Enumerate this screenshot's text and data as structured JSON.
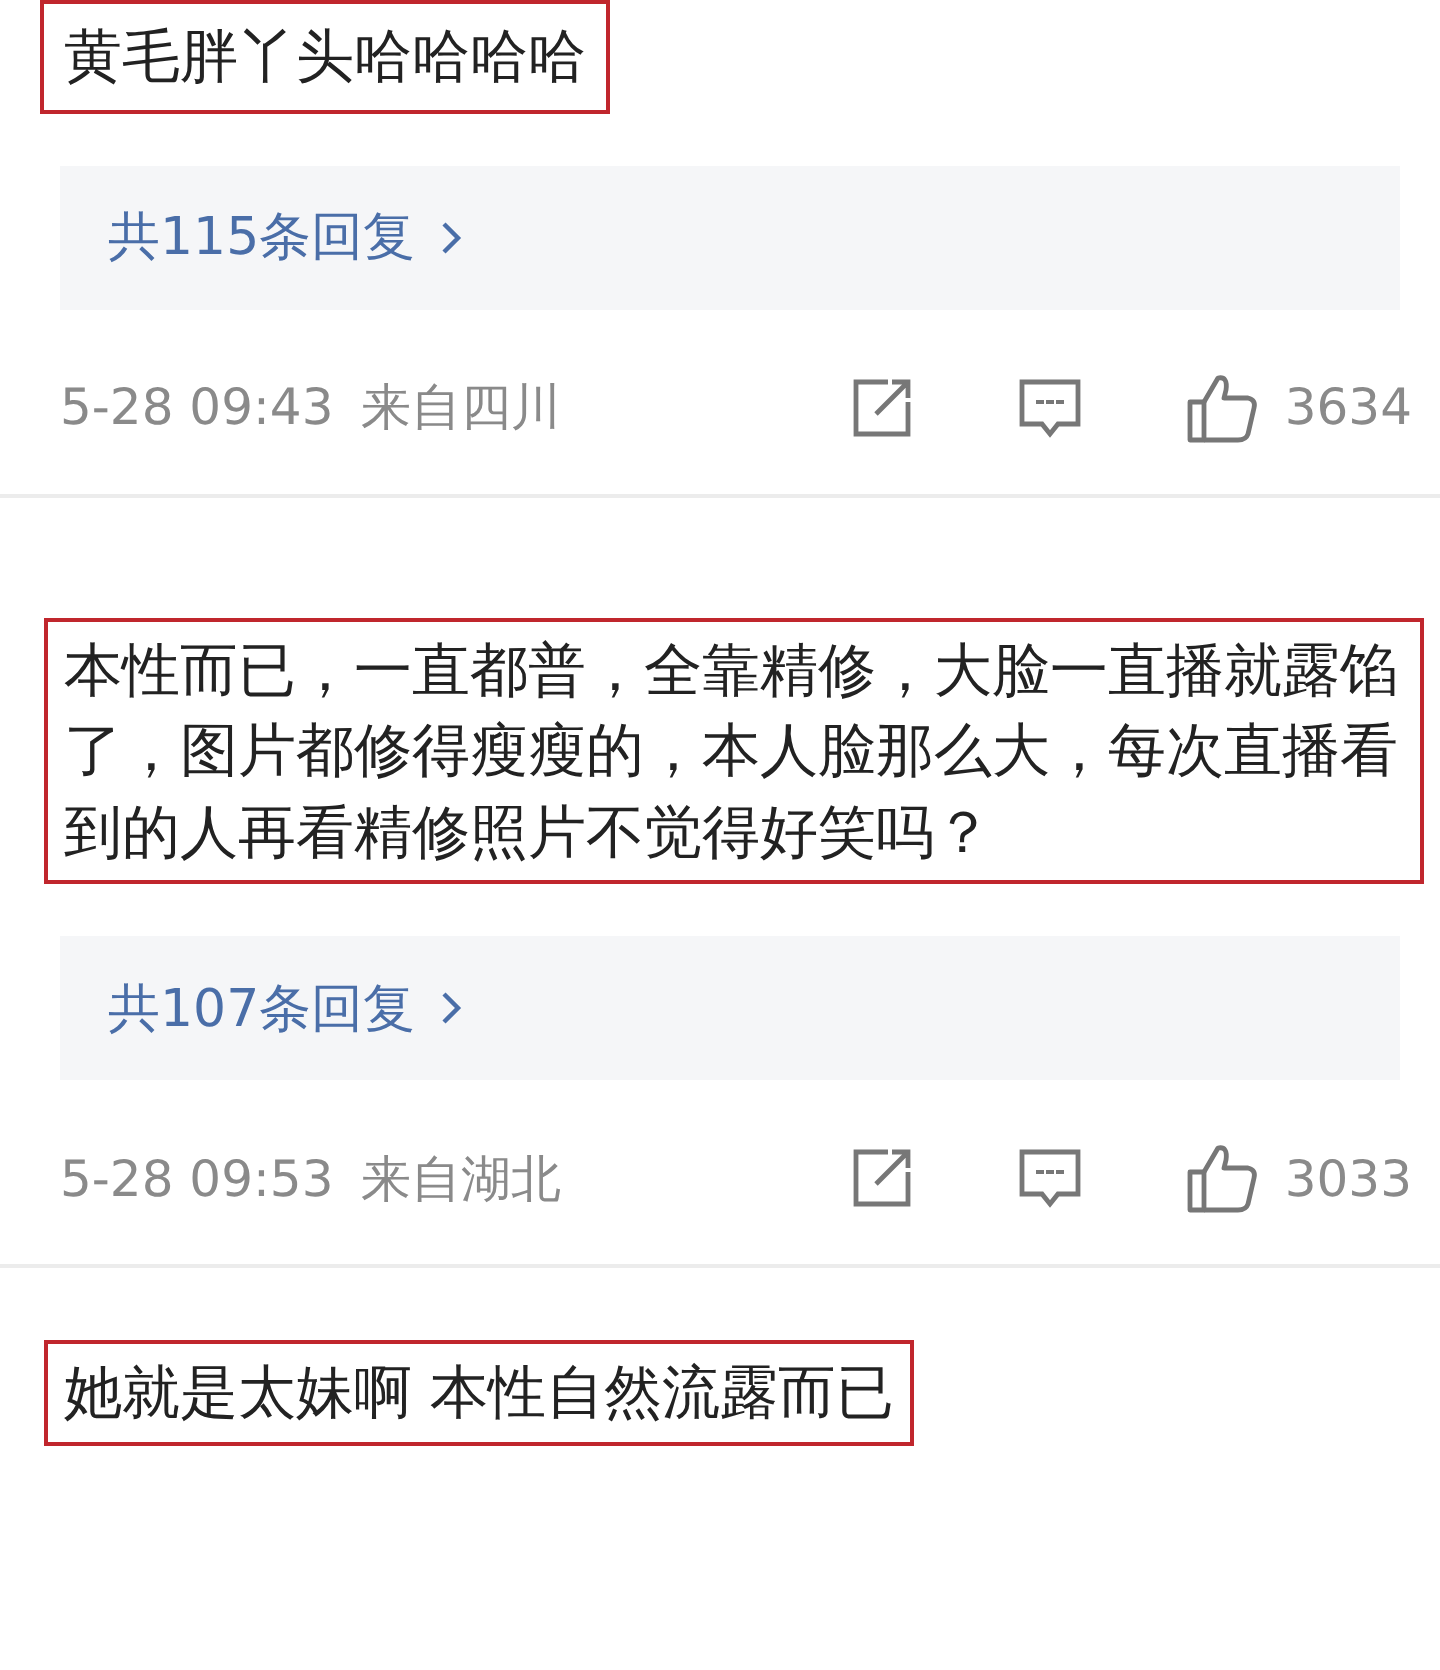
{
  "comments": [
    {
      "text": "黄毛胖丫头哈哈哈哈",
      "highlighted": true,
      "replies": "共115条回复",
      "time": "5-28 09:43",
      "location": "来自四川",
      "likes": "3634"
    },
    {
      "text": "本性而已，一直都普，全靠精修，大脸一直播就露馅了，图片都修得瘦瘦的，本人脸那么大，每次直播看到的人再看精修照片不觉得好笑吗？",
      "highlighted": true,
      "replies": "共107条回复",
      "time": "5-28 09:53",
      "location": "来自湖北",
      "likes": "3033"
    },
    {
      "text": "她就是太妹啊 本性自然流露而已",
      "highlighted": true
    }
  ]
}
